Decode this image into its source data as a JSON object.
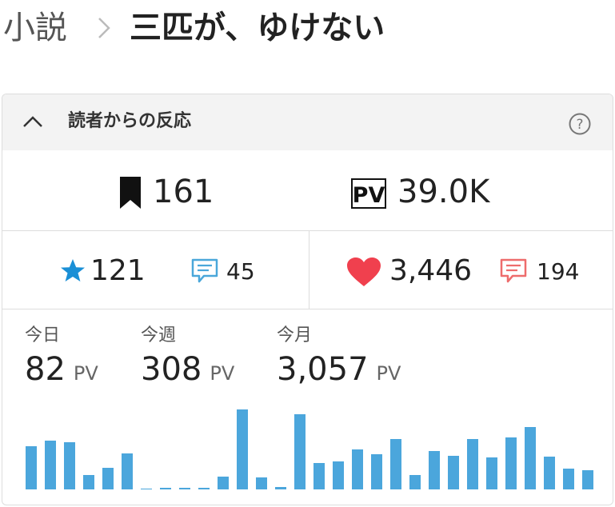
{
  "breadcrumb": {
    "parent": "小説",
    "current": "三匹が、ゆけない"
  },
  "panel": {
    "title": "読者からの反応",
    "help_symbol": "?",
    "icons": {
      "collapse": "chevron-up-icon",
      "help": "question-circle-icon",
      "bookmark": "bookmark-icon",
      "pv": "pv-icon",
      "star": "star-icon",
      "comment": "comment-icon",
      "heart": "heart-icon"
    },
    "colors": {
      "star": "#1a8fd6",
      "comment_blue": "#4aa7da",
      "heart": "#f0404e",
      "comment_red": "#ee6c6c",
      "bar": "#4ba6dc",
      "header_bg": "#f3f3f3"
    }
  },
  "reactions": {
    "bookmarks": "161",
    "pv_label": "PV",
    "pv_total": "39.0K",
    "stars": "121",
    "star_comments": "45",
    "hearts": "3,446",
    "heart_comments": "194"
  },
  "stats": [
    {
      "label": "今日",
      "value": "82",
      "unit": "PV"
    },
    {
      "label": "今週",
      "value": "308",
      "unit": "PV"
    },
    {
      "label": "今月",
      "value": "3,057",
      "unit": "PV"
    }
  ],
  "chart_data": {
    "type": "bar",
    "values": [
      54,
      61,
      59,
      18,
      27,
      45,
      0,
      2,
      2,
      2,
      16,
      100,
      15,
      3,
      94,
      33,
      35,
      50,
      44,
      63,
      18,
      48,
      42,
      63,
      40,
      65,
      78,
      41,
      26,
      24
    ],
    "ylim": [
      0,
      100
    ],
    "grid": false
  }
}
